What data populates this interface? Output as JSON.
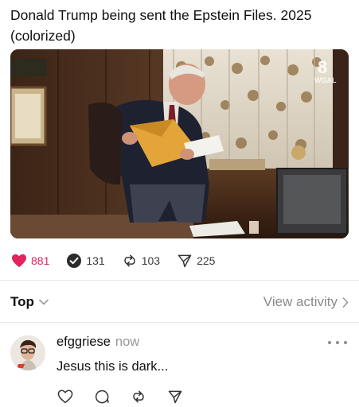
{
  "post": {
    "text": "Donald Trump being sent the Epstein Files. 2025 (colorized)",
    "media": {
      "watermark": "8",
      "watermark_sub": "WGAL"
    }
  },
  "stats": {
    "likes": "881",
    "replies": "131",
    "reposts": "103",
    "shares": "225",
    "like_color": "#e0245e"
  },
  "sort": {
    "label": "Top",
    "activity_label": "View activity"
  },
  "comment": {
    "username": "efggriese",
    "time": "now",
    "text": "Jesus this is dark...",
    "actions": [
      "heart-icon",
      "comment-icon",
      "repost-icon",
      "share-icon"
    ]
  }
}
